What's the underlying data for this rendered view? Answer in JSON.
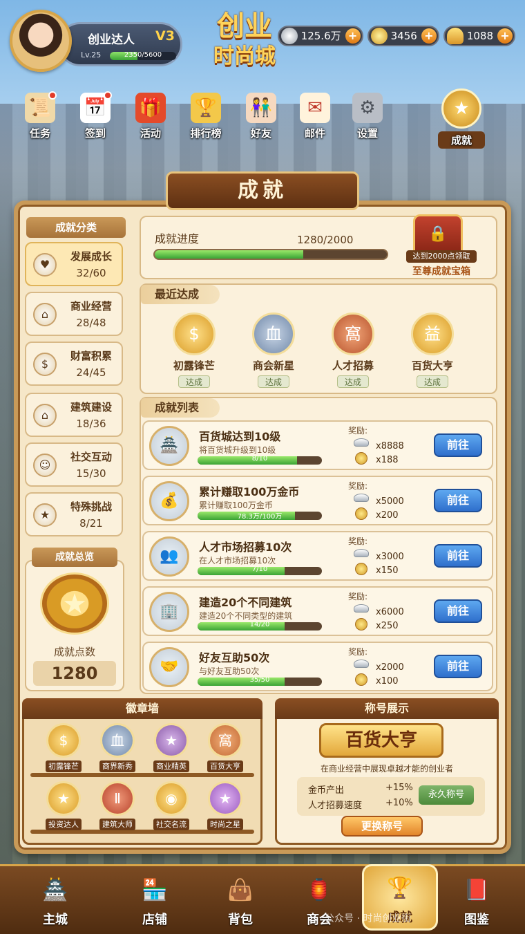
{
  "colors": {
    "accent_gold": "#e0a63a",
    "panel_bg": "#f6e7c8",
    "go_button": "#2f6fcc",
    "progress_green": "#3aa335"
  },
  "profile": {
    "name": "创业达人",
    "vip": "V3",
    "level": "Lv.25",
    "xp_text": "2350/5600",
    "xp_fraction": 0.42
  },
  "logo": {
    "line1": "创业",
    "line2": "时尚城"
  },
  "currencies": [
    {
      "icon": "silver-coin-icon",
      "color": "#c8ccd2",
      "value": "125.6万"
    },
    {
      "icon": "gold-coin-icon",
      "color": "#e9b73a",
      "value": "3456"
    },
    {
      "icon": "gold-ingot-icon",
      "color": "#f1c445",
      "value": "1088"
    }
  ],
  "top_nav": [
    {
      "label": "任务",
      "icon": "scroll-icon",
      "glyph": "📜",
      "dot": true
    },
    {
      "label": "签到",
      "icon": "calendar-icon",
      "glyph": "📅",
      "dot": true
    },
    {
      "label": "活动",
      "icon": "gift-icon",
      "glyph": "🎁",
      "dot": false
    },
    {
      "label": "排行榜",
      "icon": "trophy-icon",
      "glyph": "🏆",
      "dot": false
    },
    {
      "label": "好友",
      "icon": "friends-icon",
      "glyph": "👫",
      "dot": false
    },
    {
      "label": "邮件",
      "icon": "mail-icon",
      "glyph": "✉",
      "dot": false
    },
    {
      "label": "设置",
      "icon": "gear-icon",
      "glyph": "⚙",
      "dot": false
    },
    {
      "label": "成就",
      "icon": "achievement-icon",
      "glyph": "★",
      "dot": false,
      "active": true
    }
  ],
  "page_title": "成就",
  "categories": {
    "heading": "成就分类",
    "items": [
      {
        "name": "发展成长",
        "count": "32/60",
        "icon": "growth-icon",
        "glyph": "♥",
        "selected": true
      },
      {
        "name": "商业经营",
        "count": "28/48",
        "icon": "shop-icon",
        "glyph": "⌂"
      },
      {
        "name": "财富积累",
        "count": "24/45",
        "icon": "money-bag-icon",
        "glyph": "$"
      },
      {
        "name": "建筑建设",
        "count": "18/36",
        "icon": "building-icon",
        "glyph": "⌂"
      },
      {
        "name": "社交互动",
        "count": "15/30",
        "icon": "people-icon",
        "glyph": "☺"
      },
      {
        "name": "特殊挑战",
        "count": "8/21",
        "icon": "star-icon",
        "glyph": "★"
      }
    ]
  },
  "overview": {
    "heading": "成就总览",
    "points_label": "成就点数",
    "points_value": "1280"
  },
  "progress": {
    "label": "成就进度",
    "value_text": "1280/2000",
    "fraction": 0.64,
    "chest_note": "达到2000点领取",
    "chest_label": "至尊成就宝箱"
  },
  "recent": {
    "heading": "最近达成",
    "items": [
      {
        "name": "初露锋芒",
        "status": "达成",
        "icon": "coin-medal-icon",
        "glyph": "$",
        "color": "#d99b25"
      },
      {
        "name": "商会新星",
        "status": "达成",
        "icon": "guild-medal-icon",
        "glyph": "血",
        "color": "#6f87a8"
      },
      {
        "name": "人才招募",
        "status": "达成",
        "icon": "talent-medal-icon",
        "glyph": "窩",
        "color": "#b8532c"
      },
      {
        "name": "百货大亨",
        "status": "达成",
        "icon": "store-medal-icon",
        "glyph": "益",
        "color": "#d99b25"
      }
    ]
  },
  "list": {
    "heading": "成就列表",
    "reward_label": "奖励:",
    "go_label": "前往",
    "items": [
      {
        "title": "百货城达到10级",
        "desc": "将百货城升级到10级",
        "progress_text": "8/10",
        "fraction": 0.8,
        "reward_silver": "x8888",
        "reward_gold": "x188",
        "icon": "department-store-icon",
        "glyph": "🏯"
      },
      {
        "title": "累计赚取100万金币",
        "desc": "累计赚取100万金币",
        "progress_text": "78.3万/100万",
        "fraction": 0.783,
        "reward_silver": "x5000",
        "reward_gold": "x200",
        "icon": "coin-bag-icon",
        "glyph": "💰"
      },
      {
        "title": "人才市场招募10次",
        "desc": "在人才市场招募10次",
        "progress_text": "7/10",
        "fraction": 0.7,
        "reward_silver": "x3000",
        "reward_gold": "x150",
        "icon": "recruit-icon",
        "glyph": "👥"
      },
      {
        "title": "建造20个不同建筑",
        "desc": "建造20个不同类型的建筑",
        "progress_text": "14/20",
        "fraction": 0.7,
        "reward_silver": "x6000",
        "reward_gold": "x250",
        "icon": "buildings-icon",
        "glyph": "🏢"
      },
      {
        "title": "好友互助50次",
        "desc": "与好友互助50次",
        "progress_text": "35/50",
        "fraction": 0.7,
        "reward_silver": "x2000",
        "reward_gold": "x100",
        "icon": "handshake-icon",
        "glyph": "🤝"
      }
    ]
  },
  "badge_wall": {
    "heading": "徽章墙",
    "items": [
      {
        "label": "初露锋芒",
        "icon": "coin-badge-icon",
        "glyph": "$",
        "color": "#d99b25"
      },
      {
        "label": "商界新秀",
        "icon": "guild-badge-icon",
        "glyph": "血",
        "color": "#6f87a8"
      },
      {
        "label": "商业精英",
        "icon": "elite-badge-icon",
        "glyph": "★",
        "color": "#8a5aa8"
      },
      {
        "label": "百货大亨",
        "icon": "store-badge-icon",
        "glyph": "窩",
        "color": "#c46a34"
      },
      {
        "label": "投资达人",
        "icon": "invest-badge-icon",
        "glyph": "★",
        "color": "#d99b25"
      },
      {
        "label": "建筑大师",
        "icon": "architect-badge-icon",
        "glyph": "Ⅱ",
        "color": "#b8432c"
      },
      {
        "label": "社交名流",
        "icon": "social-badge-icon",
        "glyph": "◉",
        "color": "#d99b25"
      },
      {
        "label": "时尚之星",
        "icon": "fashion-badge-icon",
        "glyph": "★",
        "color": "#9a5ac0"
      }
    ]
  },
  "title_display": {
    "heading": "称号展示",
    "title": "百货大亨",
    "desc": "在商业经营中展现卓越才能的创业者",
    "stats": [
      {
        "name": "金币产出",
        "value": "+15%"
      },
      {
        "name": "人才招募速度",
        "value": "+10%"
      }
    ],
    "permanent": "永久称号",
    "change_button": "更换称号"
  },
  "bottom_nav": [
    {
      "label": "主城",
      "icon": "palace-icon",
      "glyph": "🏯"
    },
    {
      "label": "店铺",
      "icon": "shop-awning-icon",
      "glyph": "🏪"
    },
    {
      "label": "背包",
      "icon": "bag-icon",
      "glyph": "👜"
    },
    {
      "label": "商会",
      "icon": "guild-banner-icon",
      "glyph": "🏮"
    },
    {
      "label": "成就",
      "icon": "trophy-icon",
      "glyph": "🏆",
      "active": true
    },
    {
      "label": "图鉴",
      "icon": "book-icon",
      "glyph": "📕"
    }
  ],
  "watermark": "公众号 · 时尚创业街"
}
